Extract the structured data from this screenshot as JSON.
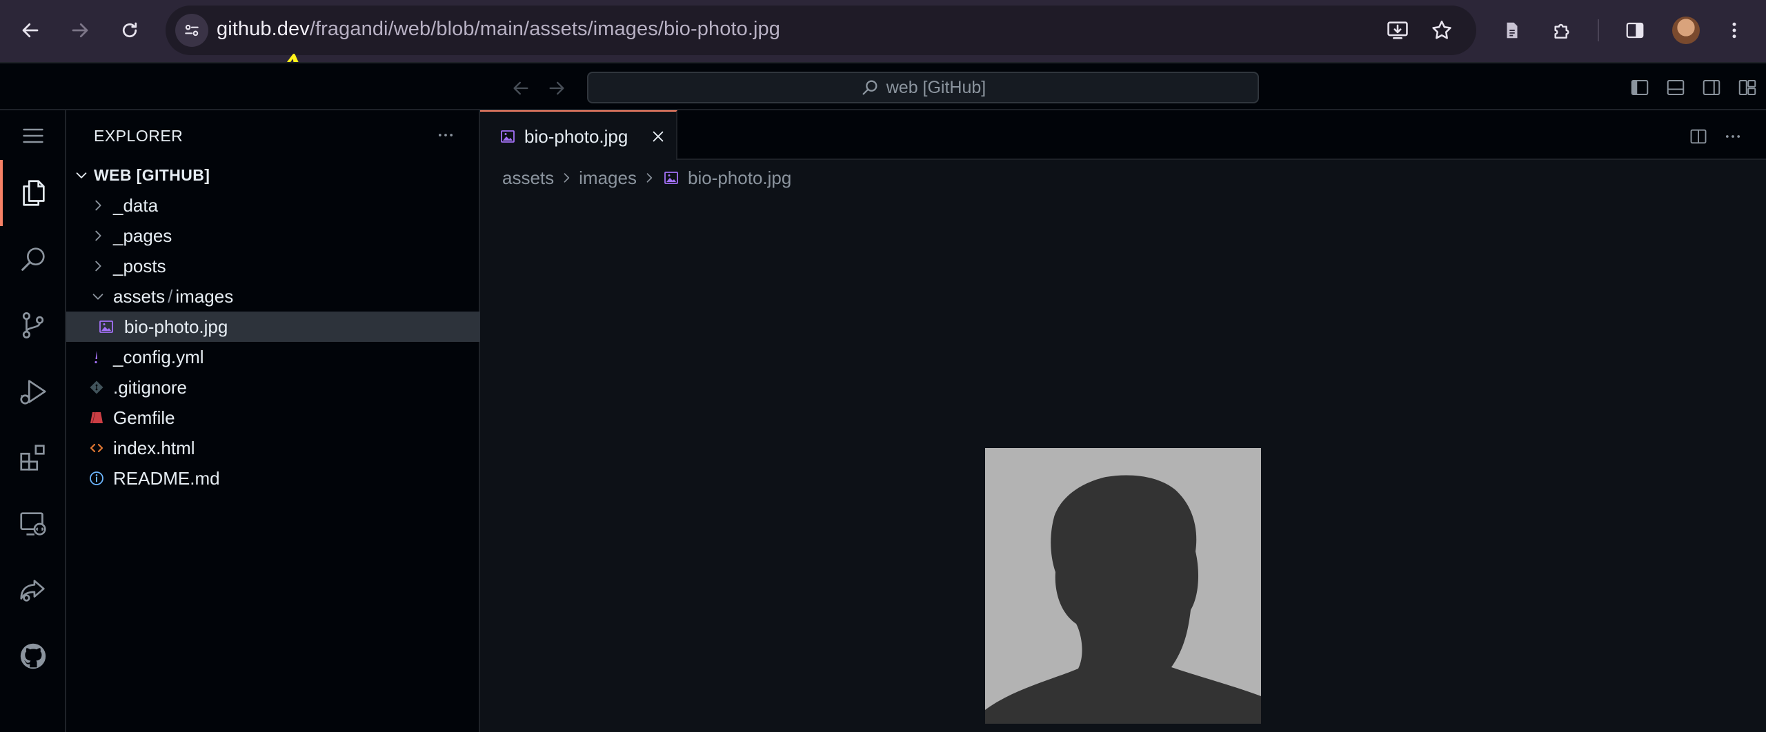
{
  "browser": {
    "url_host": "github.dev",
    "url_path": "/fragandi/web/blob/main/assets/images/bio-photo.jpg",
    "icons": [
      "back-icon",
      "forward-icon",
      "reload-icon",
      "site-info-icon",
      "install-app-icon",
      "bookmark-star-icon",
      "reading-mode-icon",
      "extensions-icon",
      "side-panel-icon",
      "profile-avatar",
      "more-menu-icon"
    ]
  },
  "titlebar": {
    "command_center": "web [GitHub]",
    "icons": [
      "back-icon",
      "forward-icon",
      "search-icon",
      "toggle-primary-sidebar-icon",
      "toggle-panel-icon",
      "toggle-secondary-sidebar-icon",
      "customize-layout-icon"
    ]
  },
  "activitybar": {
    "items": [
      "menu-icon",
      "explorer-icon",
      "search-icon",
      "source-control-icon",
      "run-debug-icon",
      "extensions-icon",
      "remote-explorer-icon",
      "live-share-icon",
      "github-icon"
    ],
    "active": "explorer-icon"
  },
  "sidebar": {
    "title": "EXPLORER",
    "root": "WEB [GITHUB]",
    "items": [
      {
        "label": "_data",
        "type": "folder",
        "expanded": false
      },
      {
        "label": "_pages",
        "type": "folder",
        "expanded": false
      },
      {
        "label": "_posts",
        "type": "folder",
        "expanded": false
      },
      {
        "label": "assets",
        "label2": "images",
        "type": "folder",
        "expanded": true
      },
      {
        "label": "bio-photo.jpg",
        "type": "image",
        "selected": true
      },
      {
        "label": "_config.yml",
        "type": "yaml"
      },
      {
        "label": ".gitignore",
        "type": "git"
      },
      {
        "label": "Gemfile",
        "type": "ruby"
      },
      {
        "label": "index.html",
        "type": "html"
      },
      {
        "label": "README.md",
        "type": "info"
      }
    ]
  },
  "editor": {
    "tab": {
      "label": "bio-photo.jpg",
      "active": true
    },
    "breadcrumb": [
      "assets",
      "images",
      "bio-photo.jpg"
    ],
    "preview": "silhouette placeholder image"
  },
  "colors": {
    "accent": "#f78166",
    "annotation": "#fff21a",
    "image_icon": "#a371f7",
    "ruby": "#cc3e44",
    "html": "#e37933",
    "info": "#6cb6ff"
  }
}
